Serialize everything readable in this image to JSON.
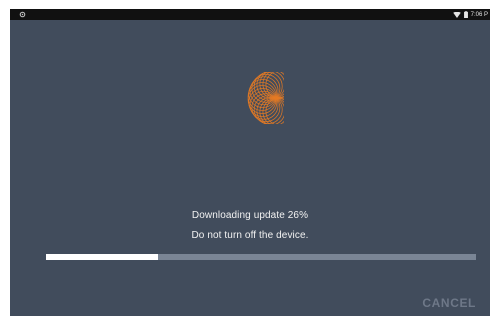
{
  "status_bar": {
    "left_icon": "settings-icon",
    "icons": [
      "wifi-icon",
      "battery-icon"
    ],
    "time": "7:06 P"
  },
  "update": {
    "logo_icon": "spirograph-logo-icon",
    "logo_color": "#e47a24",
    "title": "Downloading update 26%",
    "warning": "Do not turn off the device.",
    "progress_percent": 26
  },
  "actions": {
    "cancel_label": "CANCEL"
  }
}
